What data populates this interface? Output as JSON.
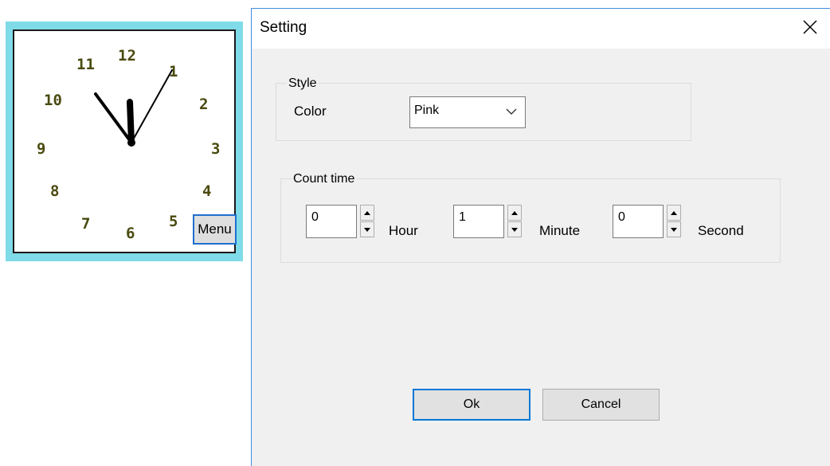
{
  "clock": {
    "numbers": [
      "12",
      "1",
      "2",
      "3",
      "4",
      "5",
      "6",
      "7",
      "8",
      "9",
      "10",
      "11"
    ],
    "menu_label": "Menu"
  },
  "dialog": {
    "title": "Setting",
    "close_icon": "close-icon",
    "style_group": {
      "label": "Style",
      "color_label": "Color",
      "color_value": "Pink"
    },
    "count_group": {
      "label": "Count time",
      "hour_value": "0",
      "hour_label": "Hour",
      "minute_value": "1",
      "minute_label": "Minute",
      "second_value": "0",
      "second_label": "Second"
    },
    "ok_label": "Ok",
    "cancel_label": "Cancel"
  },
  "colors": {
    "clock_frame": "#7fdbe8",
    "dialog_accent": "#0078d7",
    "clock_numbers": "#4a4a10"
  }
}
